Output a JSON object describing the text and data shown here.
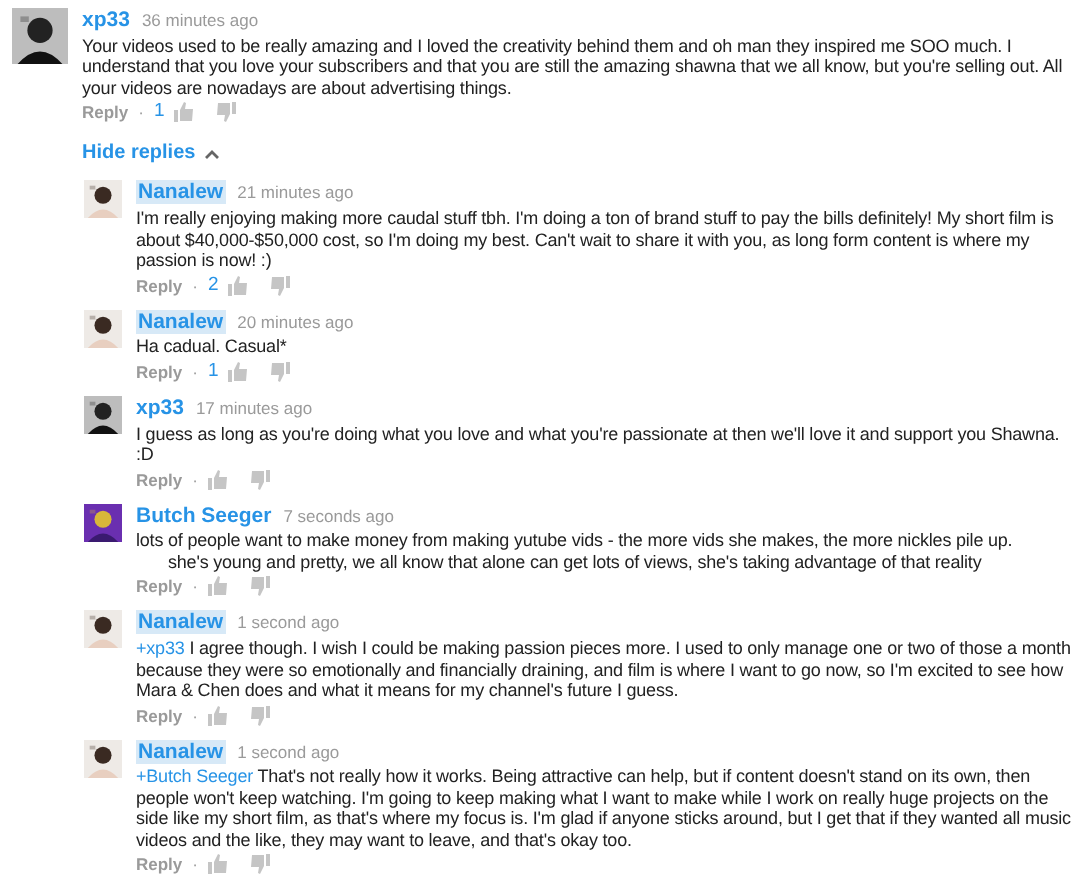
{
  "comment": {
    "author": "xp33",
    "owner": false,
    "time": "36 minutes ago",
    "body": "Your videos used to be really amazing and I loved the creativity behind them and oh man they inspired me SOO much. I understand that you love your subscribers and that you are still the amazing shawna that we all know, but you're selling out. All your videos are nowadays are about advertising things.",
    "reply": "Reply",
    "separator": "·",
    "likes": "1"
  },
  "toggle": {
    "label": "Hide replies",
    "expanded": true
  },
  "replies": [
    {
      "author": "Nanalew",
      "owner": true,
      "time": "21 minutes ago",
      "body": "I'm really enjoying making more caudal stuff tbh. I'm doing a ton of brand stuff to pay the bills definitely! My short film is about $40,000-$50,000 cost, so I'm doing my best. Can't wait to share it with you, as long form content is where my passion is now! :)",
      "reply": "Reply",
      "separator": "·",
      "likes": "2"
    },
    {
      "author": "Nanalew",
      "owner": true,
      "time": "20 minutes ago",
      "body": "Ha cadual. Casual*",
      "reply": "Reply",
      "separator": "·",
      "likes": "1"
    },
    {
      "author": "xp33",
      "owner": false,
      "time": "17 minutes ago",
      "body": "I guess as long as you're doing what you love and what you're passionate at then we'll love it and support you Shawna. :D",
      "reply": "Reply",
      "separator": "·"
    },
    {
      "author": "Butch Seeger",
      "owner": false,
      "time": "7 seconds ago",
      "body": "lots of people want to make money from making yutube vids - the more vids she makes, the more nickles pile up.",
      "continuation": "she's young and pretty, we all know that alone can get lots of views, she's taking advantage of that reality",
      "reply": "Reply",
      "separator": "·"
    },
    {
      "author": "Nanalew",
      "owner": true,
      "time": "1 second ago",
      "mention": "+xp33",
      "body": "I agree though. I wish I could be making passion pieces more. I used to only manage one or two of those a month because they were so emotionally and financially draining, and film is where I want to go now, so I'm excited to see how Mara & Chen does and what it means for my channel's future I guess.",
      "reply": "Reply",
      "separator": "·"
    },
    {
      "author": "Nanalew",
      "owner": true,
      "time": "1 second ago",
      "mention": "+Butch Seeger",
      "body": "That's not really how it works. Being attractive can help, but if content doesn't stand on its own, then people won't keep watching. I'm going to keep making what I want to make while I work on really huge projects on the side like my short film, as that's where my focus is. I'm glad if anyone sticks around, but I get that if they wanted all music videos and the like, they may want to leave, and that's okay too.",
      "reply": "Reply",
      "separator": "·"
    }
  ]
}
